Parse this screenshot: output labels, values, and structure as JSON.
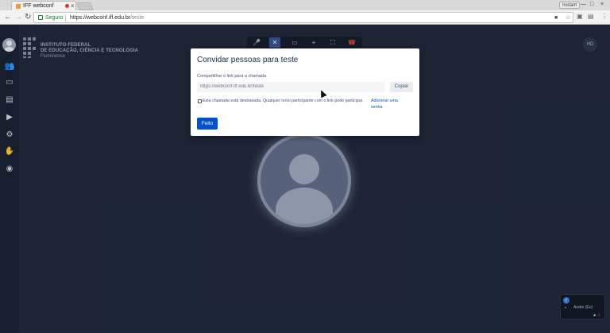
{
  "browser": {
    "tab_title": "IFF webconf",
    "tab_close": "×",
    "profile": "Instant",
    "win_minimize": "—",
    "win_maximize": "□",
    "win_close": "×",
    "nav_back": "←",
    "nav_forward": "→",
    "nav_reload": "↻",
    "secure_label": "Seguro",
    "url_host": "https://webconf.iff.edu.br",
    "url_path": "/teste"
  },
  "app": {
    "logo_line1": "INSTITUTO FEDERAL",
    "logo_line2": "DE EDUCAÇÃO, CIÊNCIA E TECNOLOGIA",
    "logo_line3": "Fluminense",
    "quality_badge": "HD",
    "self_name": "Andre (Eu)",
    "thumb_check": "✓"
  },
  "modal": {
    "title": "Convidar pessoas para teste",
    "share_label": "Compartilhar o link para a chamada",
    "link_placeholder": "https://webconf.iff.edu.br/teste",
    "copy_label": "Copiar",
    "lock_note": "Esta chamada está destravada. Qualquer novo participante com o link pode participar.",
    "add_password": "Adicionar uma senha",
    "done_label": "Feito"
  },
  "icons": {
    "accent": "#0052cc",
    "hangup": "#e74c3c"
  }
}
